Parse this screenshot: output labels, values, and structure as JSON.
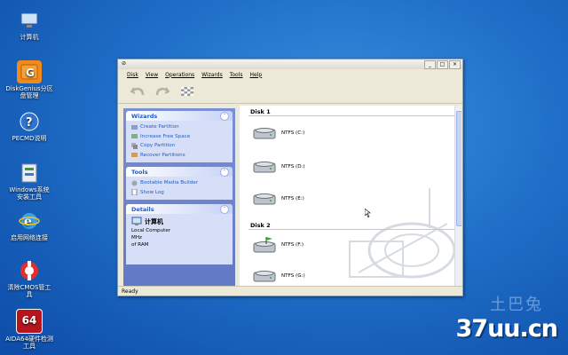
{
  "desktop": {
    "icons": [
      {
        "label": "计算机"
      },
      {
        "label": "DiskGenius分区",
        "label2": "盘管理"
      },
      {
        "label": "PECMD说明"
      },
      {
        "label": "Windows系统",
        "label2": "安装工具"
      },
      {
        "label": "启用网络连接"
      },
      {
        "label": "清除CMOS管工",
        "label2": "具"
      },
      {
        "label": "AIDA64硬件检测",
        "label2": "工具"
      }
    ],
    "icon_text_64": "64"
  },
  "window": {
    "title_icon_text": "⊘",
    "menu": [
      "Disk",
      "View",
      "Operations",
      "Wizards",
      "Tools",
      "Help"
    ],
    "status": "Ready"
  },
  "wizards": {
    "title": "Wizards",
    "items": [
      "Create Partition",
      "Increase Free Space",
      "Copy Partition",
      "Recover Partitions"
    ]
  },
  "tools": {
    "title": "Tools",
    "items": [
      "Bootable Media Builder",
      "Show Log"
    ]
  },
  "details": {
    "title": "Details",
    "name": "计算机",
    "lines": [
      "Local Computer",
      "MHz",
      "of RAM"
    ]
  },
  "disks": [
    {
      "title": "Disk 1",
      "volumes": [
        "NTFS (C:)",
        "NTFS (D:)",
        "NTFS (E:)"
      ]
    },
    {
      "title": "Disk 2",
      "volumes": [
        "NTFS (F:)",
        "NTFS (G:)"
      ]
    }
  ],
  "watermark": {
    "cn": "土巴兔",
    "site": "37uu.cn"
  },
  "colors": {
    "accent": "#215dc6",
    "desktop": "#1f6fc8"
  }
}
